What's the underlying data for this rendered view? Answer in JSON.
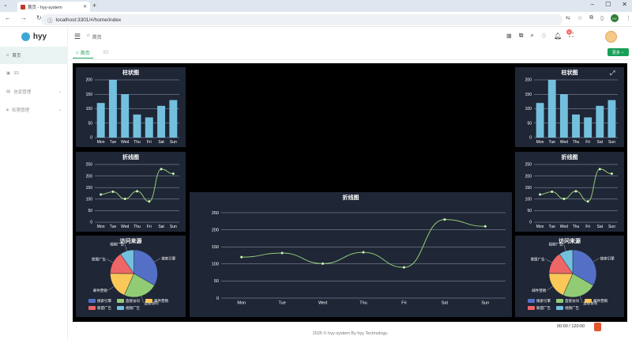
{
  "browser": {
    "tab_title": "首页 - hyy-system",
    "url": "localhost:3301/#/home/index"
  },
  "app": {
    "logo": "hyy",
    "breadcrumb": "首页",
    "notification_count": "6",
    "sidebar": [
      {
        "label": "首页",
        "icon": "home-icon",
        "active": true
      },
      {
        "label": "3D",
        "icon": "image-icon"
      },
      {
        "label": "信息管理",
        "icon": "document-icon",
        "has_children": true
      },
      {
        "label": "权限管理",
        "icon": "lock-icon",
        "has_children": true
      }
    ],
    "tabs": [
      {
        "label": "首页",
        "active": true
      },
      {
        "label": "3D"
      }
    ],
    "more_button": "更多",
    "footer": "2025 © hyy-system By hyy Technology.",
    "player_time": "00:00 / 120:00"
  },
  "colors": {
    "accent": "#18a058",
    "panel_bg": "#1f2636",
    "bar": "#73c0de",
    "line": "#91cc75"
  },
  "chart_data": [
    {
      "type": "bar",
      "title": "柱状图",
      "categories": [
        "Mon",
        "Tue",
        "Wed",
        "Thu",
        "Fri",
        "Sat",
        "Sun"
      ],
      "values": [
        120,
        200,
        150,
        80,
        70,
        110,
        130
      ],
      "ylim": [
        0,
        200
      ],
      "yticks": [
        "0",
        "50",
        "100",
        "150",
        "200"
      ]
    },
    {
      "type": "line",
      "title": "折线图",
      "categories": [
        "Mon",
        "Tue",
        "Wed",
        "Thu",
        "Fri",
        "Sat",
        "Sun"
      ],
      "values": [
        120,
        132,
        101,
        134,
        90,
        230,
        210
      ],
      "ylim": [
        0,
        250
      ],
      "yticks": [
        "0",
        "50",
        "100",
        "150",
        "200",
        "250"
      ]
    },
    {
      "type": "pie",
      "title": "访问来源",
      "slices": [
        {
          "name": "搜索引擎",
          "value": 1048,
          "color": "#5470c6"
        },
        {
          "name": "直接访问",
          "value": 735,
          "color": "#91cc75"
        },
        {
          "name": "邮件营销",
          "value": 580,
          "color": "#fac858"
        },
        {
          "name": "联盟广告",
          "value": 484,
          "color": "#ee6666"
        },
        {
          "name": "视频广告",
          "value": 300,
          "color": "#73c0de"
        }
      ]
    }
  ]
}
